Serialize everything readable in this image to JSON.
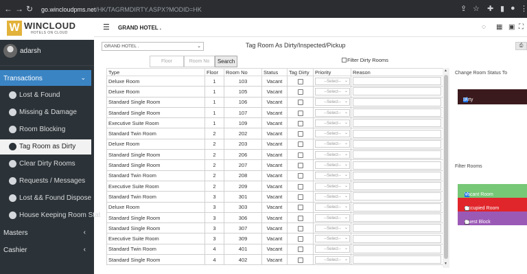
{
  "browser": {
    "url_host": "go.wincloudpms.net",
    "url_path": "/HK/TAGRMDIRTY.ASPX?MODID=HK"
  },
  "logo": {
    "name": "WINCLOUD",
    "tagline": "HOTELS ON CLOUD",
    "mark": "W"
  },
  "user": {
    "name": "adarsh"
  },
  "sidebar": {
    "transactions_label": "Transactions",
    "items": [
      "Lost & Found",
      "Missing & Damage",
      "Room Blocking",
      "Tag Room as Dirty",
      "Clear Dirty Rooms",
      "Requests / Messages",
      "Lost && Found Dispose",
      "House Keeping Room Stat"
    ],
    "active_index": 3,
    "sections": [
      "Masters",
      "Cashier"
    ]
  },
  "topbar": {
    "hotel_name": "GRAND HOTEL ."
  },
  "filters": {
    "hotel_select": "GRAND HOTEL .",
    "floor_placeholder": "Floor",
    "roomno_placeholder": "Room No",
    "search_label": "Search",
    "filter_dirty_label": "Filter Dirty Rooms"
  },
  "page_title": "Tag Room As Dirty/Inspected/Pickup",
  "table": {
    "columns": [
      "Type",
      "Floor",
      "Room No",
      "Status",
      "Tag Dirty",
      "Priority",
      "Reason"
    ],
    "priority_placeholder": "--Select--",
    "rows": [
      {
        "type": "Deluxe Room",
        "floor": "1",
        "room": "103",
        "status": "Vacant"
      },
      {
        "type": "Deluxe Room",
        "floor": "1",
        "room": "105",
        "status": "Vacant"
      },
      {
        "type": "Standard Single Room",
        "floor": "1",
        "room": "106",
        "status": "Vacant"
      },
      {
        "type": "Standard Single Room",
        "floor": "1",
        "room": "107",
        "status": "Vacant"
      },
      {
        "type": "Executive Suite Room",
        "floor": "1",
        "room": "109",
        "status": "Vacant"
      },
      {
        "type": "Standard Twin Room",
        "floor": "2",
        "room": "202",
        "status": "Vacant"
      },
      {
        "type": "Deluxe Room",
        "floor": "2",
        "room": "203",
        "status": "Vacant"
      },
      {
        "type": "Standard Single Room",
        "floor": "2",
        "room": "206",
        "status": "Vacant"
      },
      {
        "type": "Standard Single Room",
        "floor": "2",
        "room": "207",
        "status": "Vacant"
      },
      {
        "type": "Standard Twin Room",
        "floor": "2",
        "room": "208",
        "status": "Vacant"
      },
      {
        "type": "Executive Suite Room",
        "floor": "2",
        "room": "209",
        "status": "Vacant"
      },
      {
        "type": "Standard Twin Room",
        "floor": "3",
        "room": "301",
        "status": "Vacant"
      },
      {
        "type": "Deluxe Room",
        "floor": "3",
        "room": "303",
        "status": "Vacant"
      },
      {
        "type": "Standard Single Room",
        "floor": "3",
        "room": "306",
        "status": "Vacant"
      },
      {
        "type": "Standard Single Room",
        "floor": "3",
        "room": "307",
        "status": "Vacant"
      },
      {
        "type": "Executive Suite Room",
        "floor": "3",
        "room": "309",
        "status": "Vacant"
      },
      {
        "type": "Standard Twin Room",
        "floor": "4",
        "room": "401",
        "status": "Vacant"
      },
      {
        "type": "Standard Single Room",
        "floor": "4",
        "room": "402",
        "status": "Vacant"
      }
    ]
  },
  "right_panel": {
    "change_status_label": "Change Room Status To",
    "status_option": "Dirty",
    "status_color": "#3b1a1e",
    "filter_rooms_label": "Filter Rooms",
    "filters": [
      {
        "label": "Vacant Room",
        "color": "#76c776",
        "checked": true
      },
      {
        "label": "Occupied Room",
        "color": "#e0262b",
        "checked": false
      },
      {
        "label": "Guest Block",
        "color": "#9b59b6",
        "checked": false
      }
    ]
  }
}
